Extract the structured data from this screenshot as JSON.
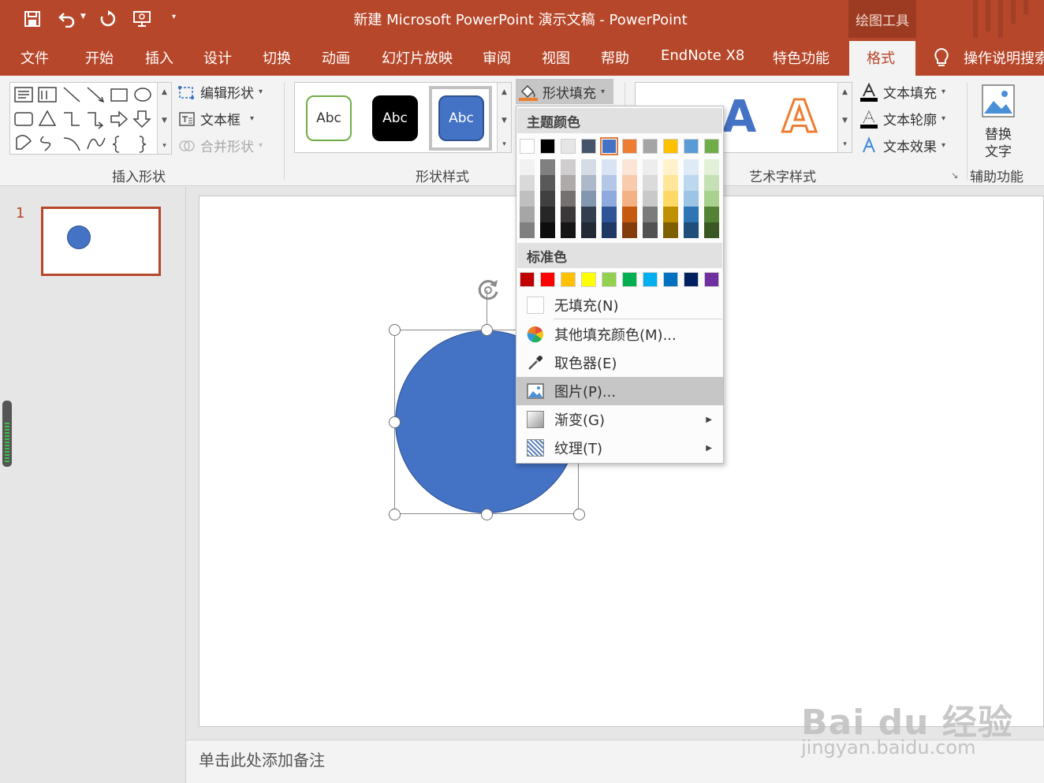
{
  "window": {
    "title": "新建 Microsoft PowerPoint 演示文稿  -  PowerPoint",
    "contextual_tab_group": "绘图工具"
  },
  "quick_access": {
    "save_icon": "save-icon",
    "undo_icon": "undo-icon",
    "redo_icon": "redo-icon",
    "slideshow_icon": "present-from-start-icon",
    "customize_icon": "customize-dropdown-icon"
  },
  "tabs": [
    "文件",
    "开始",
    "插入",
    "设计",
    "切换",
    "动画",
    "幻灯片放映",
    "审阅",
    "视图",
    "帮助",
    "EndNote X8",
    "特色功能",
    "格式"
  ],
  "active_tab": "格式",
  "tell_me": "操作说明搜索",
  "ribbon": {
    "insert_shapes": {
      "label": "插入形状",
      "edit_shape": "编辑形状",
      "text_box": "文本框",
      "merge_shapes": "合并形状"
    },
    "shape_styles": {
      "label": "形状样式",
      "style_sample": "Abc",
      "shape_fill": "形状填充"
    },
    "wordart_styles": {
      "label": "艺术字样式",
      "sample": "A",
      "text_fill": "文本填充",
      "text_outline": "文本轮廓",
      "text_effects": "文本效果"
    },
    "accessibility": {
      "label": "辅助功能",
      "alt_text_line1": "替换",
      "alt_text_line2": "文字"
    }
  },
  "slides_panel": {
    "slide_number": "1"
  },
  "notes_placeholder": "单击此处添加备注",
  "fill_menu": {
    "theme_colors_header": "主题颜色",
    "theme_colors": [
      "#ffffff",
      "#000000",
      "#e7e6e6",
      "#44546a",
      "#4472c4",
      "#ed7d31",
      "#a5a5a5",
      "#ffc000",
      "#5b9bd5",
      "#70ad47"
    ],
    "theme_shades": [
      [
        "#f2f2f2",
        "#d9d9d9",
        "#bfbfbf",
        "#a6a6a6",
        "#808080"
      ],
      [
        "#808080",
        "#595959",
        "#404040",
        "#262626",
        "#0d0d0d"
      ],
      [
        "#d0cece",
        "#aeaaaa",
        "#757171",
        "#3a3838",
        "#171616"
      ],
      [
        "#d6dce5",
        "#adb9ca",
        "#8497b0",
        "#333f50",
        "#222a35"
      ],
      [
        "#dae3f3",
        "#b4c7e7",
        "#8faadc",
        "#2f5597",
        "#1f3864"
      ],
      [
        "#fbe5d6",
        "#f8cbad",
        "#f4b183",
        "#c55a11",
        "#843c0c"
      ],
      [
        "#ededed",
        "#dbdbdb",
        "#c9c9c9",
        "#7b7b7b",
        "#525252"
      ],
      [
        "#fff2cc",
        "#ffe699",
        "#ffd966",
        "#bf9000",
        "#7f6000"
      ],
      [
        "#deebf7",
        "#bdd7ee",
        "#9dc3e6",
        "#2e75b6",
        "#1f4e79"
      ],
      [
        "#e2f0d9",
        "#c5e0b4",
        "#a9d18e",
        "#548235",
        "#385723"
      ]
    ],
    "standard_colors_header": "标准色",
    "standard_colors": [
      "#c00000",
      "#ff0000",
      "#ffc000",
      "#ffff00",
      "#92d050",
      "#00b050",
      "#00b0f0",
      "#0070c0",
      "#002060",
      "#7030a0"
    ],
    "no_fill": "无填充(N)",
    "more_colors": "其他填充颜色(M)...",
    "eyedropper": "取色器(E)",
    "picture": "图片(P)...",
    "gradient": "渐变(G)",
    "texture": "纹理(T)"
  },
  "colors": {
    "accent": "#b7472a",
    "shape_fill": "#4472c4",
    "wordart_orange": "#ed7d31"
  },
  "watermark": {
    "brand": "Bai du 经验",
    "url": "jingyan.baidu.com"
  }
}
